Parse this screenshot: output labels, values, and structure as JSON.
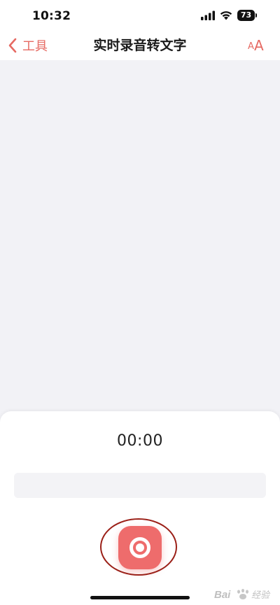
{
  "status_bar": {
    "time": "10:32",
    "battery": "73"
  },
  "nav": {
    "back_label": "工具",
    "title": "实时录音转文字",
    "font_size_small": "A",
    "font_size_large": "A"
  },
  "recorder": {
    "timer": "00:00"
  },
  "watermark": {
    "text": "Bai 经验"
  },
  "colors": {
    "accent": "#e66a63",
    "record_button": "#ee6c6c",
    "highlight_annotation": "#9b2018",
    "transcript_background": "#f2f2f6"
  }
}
